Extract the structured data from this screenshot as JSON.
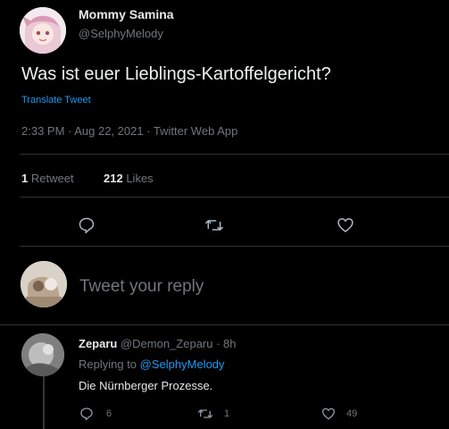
{
  "tweet": {
    "author_name": "Mommy Samina",
    "author_handle": "@SelphyMelody",
    "text": "Was ist euer Lieblings-Kartoffelgericht?",
    "translate_label": "Translate Tweet",
    "timestamp": "2:33 PM · Aug 22, 2021 · Twitter Web App",
    "retweets_count": "1",
    "retweets_label": "Retweet",
    "likes_count": "212",
    "likes_label": "Likes"
  },
  "reply_box": {
    "placeholder": "Tweet your reply"
  },
  "reply": {
    "author_name": "Zeparu",
    "meta": "@Demon_Zeparu · 8h",
    "replying_to_label": "Replying to",
    "replying_to_handle": "@SelphyMelody",
    "text": "Die Nürnberger Prozesse.",
    "reply_count": "6",
    "retweet_count": "1",
    "like_count": "49"
  },
  "icons": {
    "reply": "reply-icon",
    "retweet": "retweet-icon",
    "like": "heart-icon"
  },
  "colors": {
    "background": "#000000",
    "text": "#e7e9ea",
    "muted": "#71767b",
    "accent": "#1d9bf0",
    "divider": "#2f3336"
  }
}
